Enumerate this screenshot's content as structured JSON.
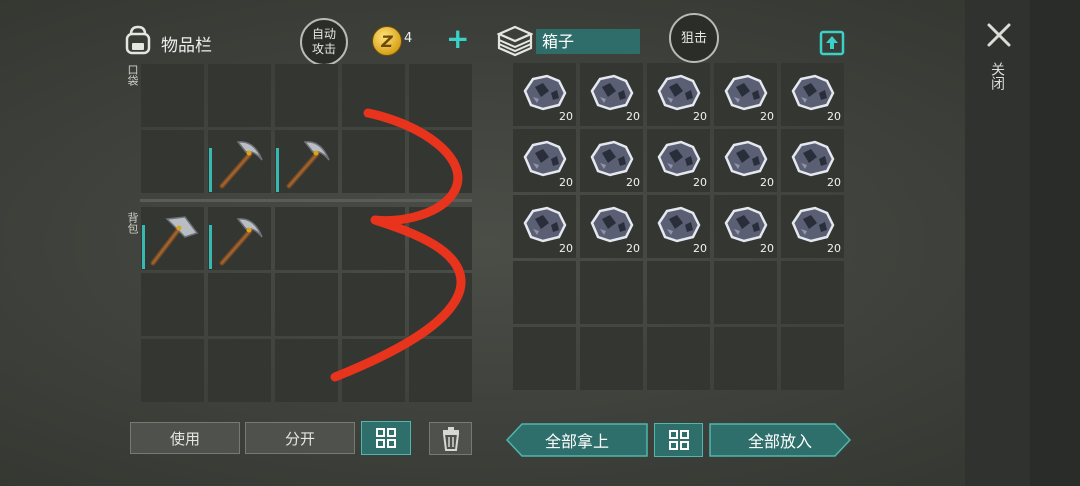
{
  "header": {
    "inventory_title": "物品栏",
    "auto_attack_label": "自动\n攻击",
    "coin_count": "4",
    "box_name": "箱子",
    "snipe_label": "狙击",
    "close_label": "关闭"
  },
  "inventory": {
    "pocket_label": "口袋",
    "backpack_label": "背包",
    "pocket_slots": [
      {
        "item": "empty"
      },
      {
        "item": "empty"
      },
      {
        "item": "empty"
      },
      {
        "item": "empty"
      },
      {
        "item": "empty"
      },
      {
        "item": "empty"
      },
      {
        "item": "pickaxe"
      },
      {
        "item": "pickaxe"
      },
      {
        "item": "empty"
      },
      {
        "item": "empty"
      }
    ],
    "backpack_slots": [
      {
        "item": "hammer"
      },
      {
        "item": "pickaxe"
      },
      {
        "item": "empty"
      },
      {
        "item": "empty"
      },
      {
        "item": "empty"
      },
      {
        "item": "empty"
      },
      {
        "item": "empty"
      },
      {
        "item": "empty"
      },
      {
        "item": "empty"
      },
      {
        "item": "empty"
      },
      {
        "item": "empty"
      },
      {
        "item": "empty"
      },
      {
        "item": "empty"
      },
      {
        "item": "empty"
      },
      {
        "item": "empty"
      }
    ]
  },
  "box": {
    "slots": [
      {
        "item": "iron-ore",
        "count": "20"
      },
      {
        "item": "iron-ore",
        "count": "20"
      },
      {
        "item": "iron-ore",
        "count": "20"
      },
      {
        "item": "iron-ore",
        "count": "20"
      },
      {
        "item": "iron-ore",
        "count": "20"
      },
      {
        "item": "iron-ore",
        "count": "20"
      },
      {
        "item": "iron-ore",
        "count": "20"
      },
      {
        "item": "iron-ore",
        "count": "20"
      },
      {
        "item": "iron-ore",
        "count": "20"
      },
      {
        "item": "iron-ore",
        "count": "20"
      },
      {
        "item": "iron-ore",
        "count": "20"
      },
      {
        "item": "iron-ore",
        "count": "20"
      },
      {
        "item": "iron-ore",
        "count": "20"
      },
      {
        "item": "iron-ore",
        "count": "20"
      },
      {
        "item": "iron-ore",
        "count": "20"
      },
      {
        "item": "empty",
        "count": ""
      },
      {
        "item": "empty",
        "count": ""
      },
      {
        "item": "empty",
        "count": ""
      },
      {
        "item": "empty",
        "count": ""
      },
      {
        "item": "empty",
        "count": ""
      },
      {
        "item": "empty",
        "count": ""
      },
      {
        "item": "empty",
        "count": ""
      },
      {
        "item": "empty",
        "count": ""
      },
      {
        "item": "empty",
        "count": ""
      },
      {
        "item": "empty",
        "count": ""
      }
    ]
  },
  "actions": {
    "use_label": "使用",
    "split_label": "分开",
    "take_all_label": "全部拿上",
    "put_all_label": "全部放入"
  },
  "colors": {
    "accent_teal": "#2e6f6b",
    "accent_teal_light": "#39d2c8",
    "slot_bg": "#343632",
    "annotation_red": "#e8341c"
  }
}
